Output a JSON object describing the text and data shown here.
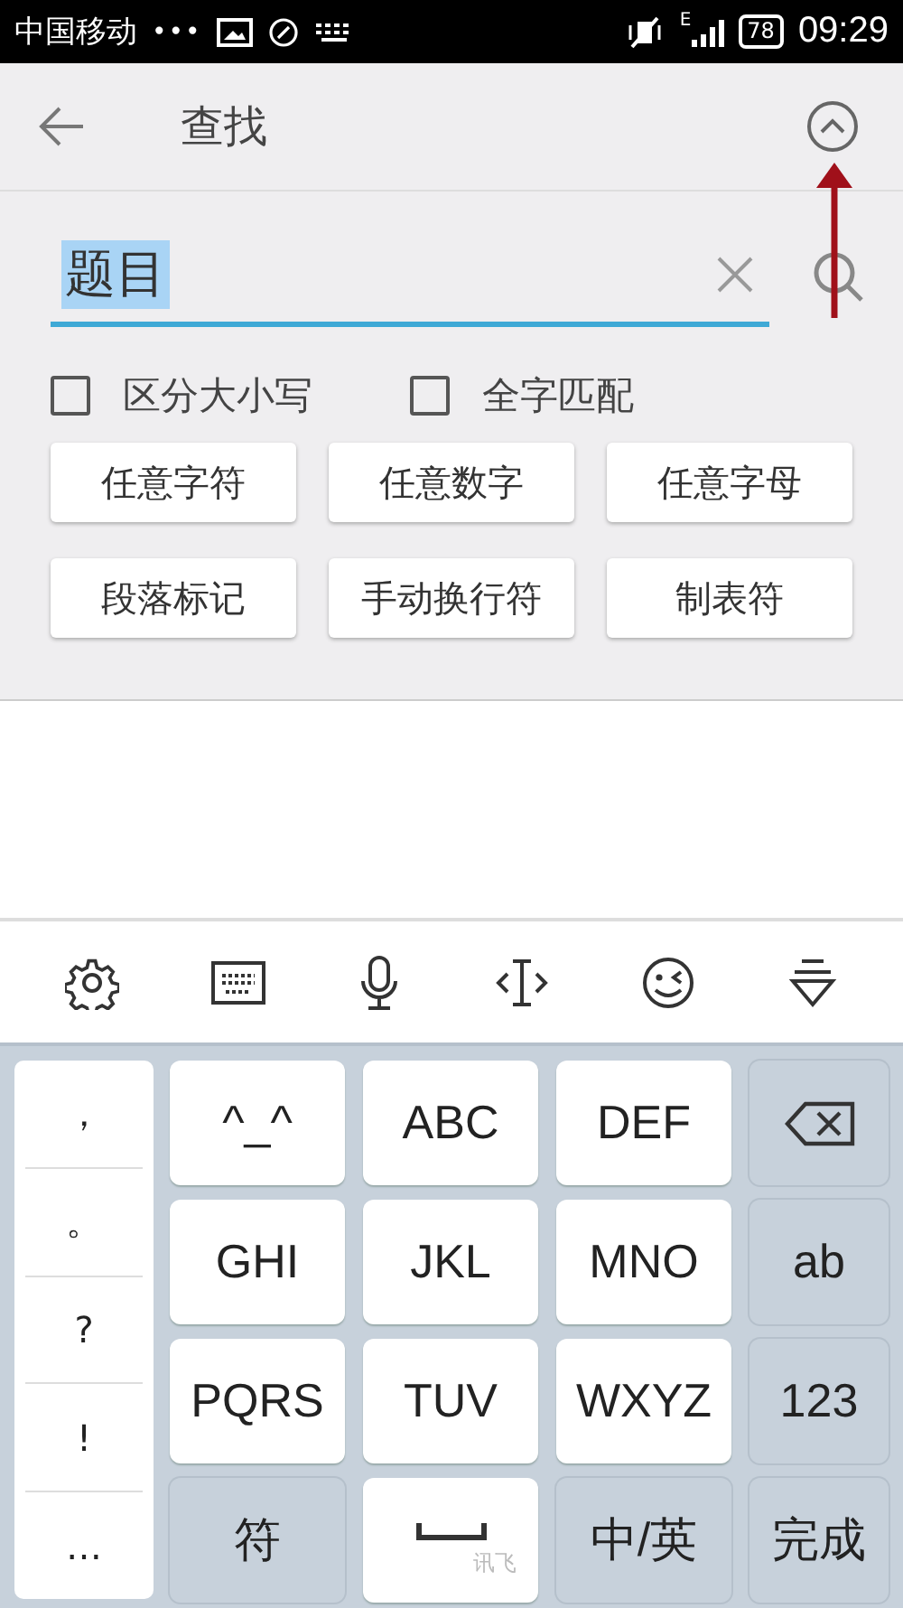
{
  "status_bar": {
    "carrier": "中国移动",
    "dots": "•••",
    "battery": "78",
    "signal_label": "E",
    "time": "09:29"
  },
  "header": {
    "title": "查找"
  },
  "search": {
    "value": "题目",
    "text_selected": true
  },
  "options": [
    {
      "label": "区分大小写",
      "checked": false
    },
    {
      "label": "全字匹配",
      "checked": false
    }
  ],
  "buttons": [
    "任意字符",
    "任意数字",
    "任意字母",
    "段落标记",
    "手动换行符",
    "制表符"
  ],
  "toolbar": [
    {
      "kind": "settings"
    },
    {
      "kind": "keyboard"
    },
    {
      "kind": "mic"
    },
    {
      "kind": "cursor"
    },
    {
      "kind": "emoji"
    },
    {
      "kind": "hide"
    }
  ],
  "keyboard": {
    "punctuation": [
      "，",
      "。",
      "?",
      "!",
      "…"
    ],
    "keys": [
      {
        "kind": "char",
        "label": "^_^"
      },
      {
        "kind": "char",
        "label": "ABC"
      },
      {
        "kind": "char",
        "label": "DEF"
      },
      {
        "kind": "backspace"
      },
      {
        "kind": "char",
        "label": "GHI"
      },
      {
        "kind": "char",
        "label": "JKL"
      },
      {
        "kind": "char",
        "label": "MNO"
      },
      {
        "kind": "function",
        "label": "ab"
      },
      {
        "kind": "char",
        "label": "PQRS"
      },
      {
        "kind": "char",
        "label": "TUV"
      },
      {
        "kind": "char",
        "label": "WXYZ"
      },
      {
        "kind": "function",
        "label": "123"
      },
      {
        "kind": "function",
        "label": "符"
      },
      {
        "kind": "space",
        "label": "讯飞"
      },
      {
        "kind": "function",
        "label": "中/英"
      },
      {
        "kind": "function",
        "label": "完成"
      }
    ]
  }
}
